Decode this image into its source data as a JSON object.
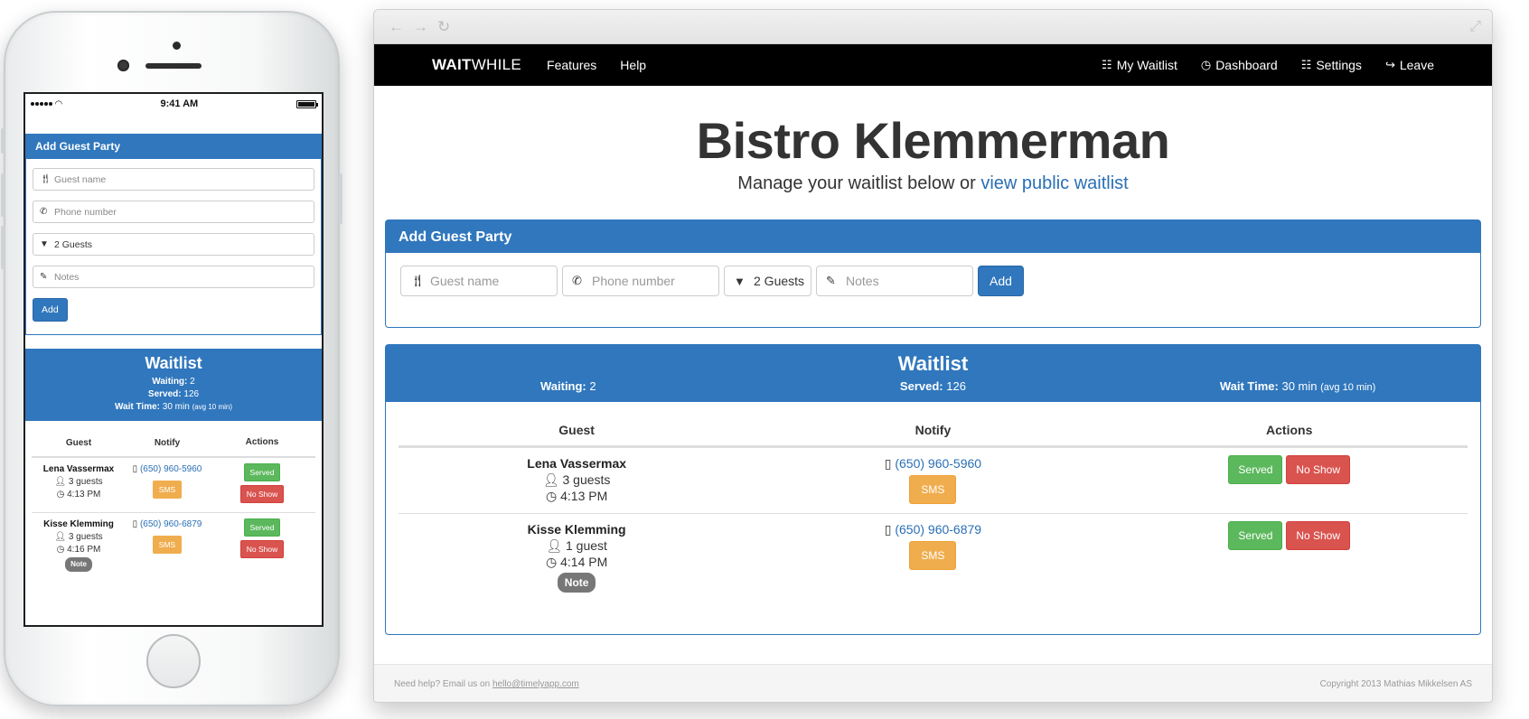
{
  "mobile": {
    "status": {
      "time": "9:41 AM"
    },
    "form": {
      "title": "Add Guest Party",
      "guest_placeholder": "Guest name",
      "phone_placeholder": "Phone number",
      "party_size": "2 Guests",
      "notes_placeholder": "Notes",
      "add_label": "Add"
    },
    "waitlist": {
      "title": "Waitlist",
      "waiting_label": "Waiting:",
      "waiting_value": "2",
      "served_label": "Served:",
      "served_value": "126",
      "wait_label": "Wait Time:",
      "wait_value": "30 min",
      "wait_avg": "(avg 10 min)",
      "col_guest": "Guest",
      "col_notify": "Notify",
      "col_actions": "Actions",
      "rows": [
        {
          "name": "Lena Vassermax",
          "guests": "3 guests",
          "time": "4:13 PM",
          "phone": "(650) 960-5960",
          "sms": "SMS",
          "served": "Served",
          "noshow": "No Show"
        },
        {
          "name": "Kisse Klemming",
          "guests": "3 guests",
          "time": "4:16 PM",
          "phone": "(650) 960-6879",
          "sms": "SMS",
          "served": "Served",
          "noshow": "No Show",
          "note": "Note"
        }
      ]
    }
  },
  "desktop": {
    "navbar": {
      "brand_bold": "WAIT",
      "brand_rest": "WHILE",
      "features": "Features",
      "help": "Help",
      "my_waitlist": "My Waitlist",
      "dashboard": "Dashboard",
      "settings": "Settings",
      "leave": "Leave"
    },
    "header": {
      "title": "Bistro Klemmerman",
      "subtitle": "Manage your waitlist below or",
      "subtitle_link": "view public waitlist"
    },
    "form": {
      "title": "Add Guest Party",
      "guest_placeholder": "Guest name",
      "phone_placeholder": "Phone number",
      "party_size": "2 Guests",
      "notes_placeholder": "Notes",
      "add_label": "Add"
    },
    "waitlist": {
      "title": "Waitlist",
      "waiting_label": "Waiting:",
      "waiting_value": "2",
      "served_label": "Served:",
      "served_value": "126",
      "wait_label": "Wait Time:",
      "wait_value": "30 min",
      "wait_avg": "(avg 10 min)",
      "col_guest": "Guest",
      "col_notify": "Notify",
      "col_actions": "Actions",
      "rows": [
        {
          "name": "Lena Vassermax",
          "guests": "3 guests",
          "time": "4:13 PM",
          "phone": "(650) 960-5960",
          "sms": "SMS",
          "served": "Served",
          "noshow": "No Show"
        },
        {
          "name": "Kisse Klemming",
          "guests": "1 guest",
          "time": "4:14 PM",
          "phone": "(650) 960-6879",
          "sms": "SMS",
          "served": "Served",
          "noshow": "No Show",
          "note": "Note"
        }
      ]
    },
    "footer": {
      "help_text": "Need help? Email us on",
      "email": "hello@timelyapp.com",
      "copyright": "Copyright 2013 Mathias Mikkelsen AS"
    }
  },
  "colors": {
    "primary": "#3077bd",
    "success": "#5cb85c",
    "danger": "#d9534f",
    "warning": "#f0ad4e",
    "navbar": "#000000"
  }
}
